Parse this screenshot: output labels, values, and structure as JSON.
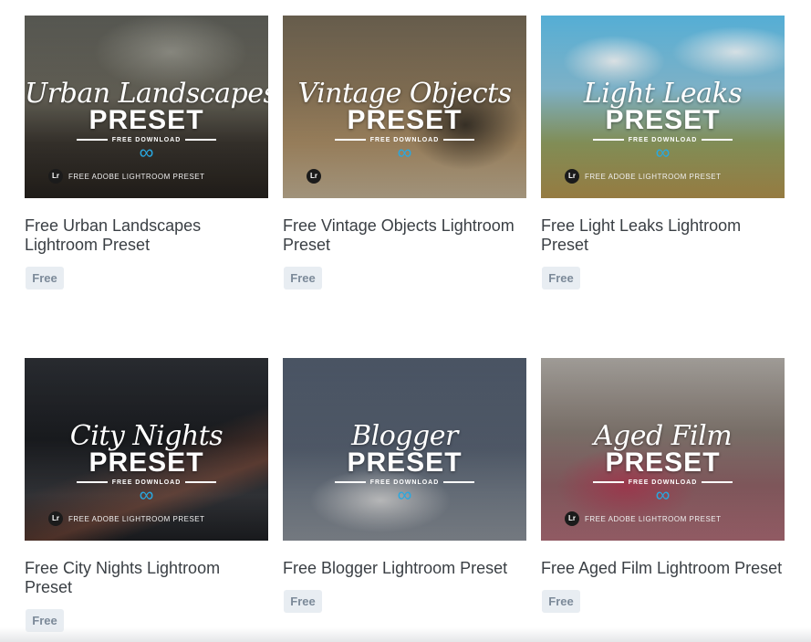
{
  "products": [
    {
      "image_script": "Urban Landscapes",
      "image_preset": "PRESET",
      "image_free_download": "FREE DOWNLOAD",
      "image_lr_text": "FREE ADOBE LIGHTROOM PRESET",
      "title": "Free Urban Landscapes Lightroom Preset",
      "badge": "Free"
    },
    {
      "image_script": "Vintage Objects",
      "image_preset": "PRESET",
      "image_free_download": "FREE DOWNLOAD",
      "image_lr_text": "",
      "title": "Free Vintage Objects Lightroom Preset",
      "badge": "Free"
    },
    {
      "image_script": "Light Leaks",
      "image_preset": "PRESET",
      "image_free_download": "FREE DOWNLOAD",
      "image_lr_text": "FREE ADOBE LIGHTROOM PRESET",
      "title": "Free Light Leaks Lightroom Preset",
      "badge": "Free"
    },
    {
      "image_script": "City Nights",
      "image_preset": "PRESET",
      "image_free_download": "FREE DOWNLOAD",
      "image_lr_text": "FREE ADOBE LIGHTROOM PRESET",
      "title": "Free City Nights Lightroom Preset",
      "badge": "Free"
    },
    {
      "image_script": "Blogger",
      "image_preset": "PRESET",
      "image_free_download": "FREE DOWNLOAD",
      "image_lr_text": "",
      "title": "Free Blogger Lightroom Preset",
      "badge": "Free"
    },
    {
      "image_script": "Aged Film",
      "image_preset": "PRESET",
      "image_free_download": "FREE DOWNLOAD",
      "image_lr_text": "FREE ADOBE LIGHTROOM PRESET",
      "title": "Free Aged Film Lightroom Preset",
      "badge": "Free"
    }
  ],
  "icons": {
    "lightroom_logo": "lightroom-logo-icon",
    "infinity": "infinity-icon"
  },
  "colors": {
    "badge_bg": "#e8edf2",
    "badge_text": "#7c8a99",
    "title_text": "#3a3f44",
    "infinity": "#29a8e0"
  }
}
